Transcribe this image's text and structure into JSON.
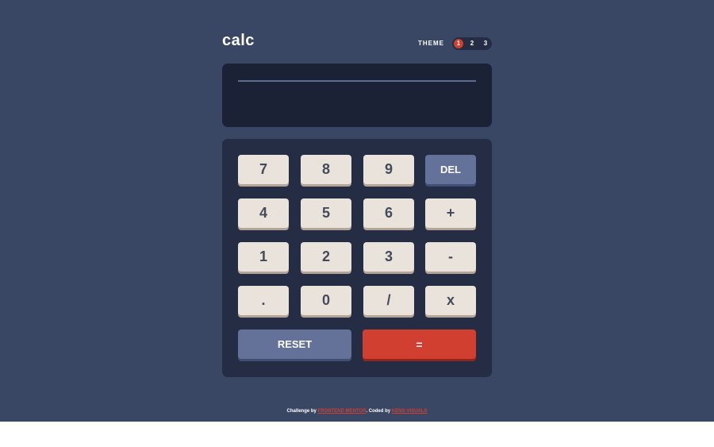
{
  "header": {
    "logo": "calc",
    "theme_label": "THEME",
    "theme_options": [
      "1",
      "2",
      "3"
    ],
    "theme_selected": "1"
  },
  "display": {
    "value": ""
  },
  "keys": {
    "seven": "7",
    "eight": "8",
    "nine": "9",
    "del": "DEL",
    "four": "4",
    "five": "5",
    "six": "6",
    "plus": "+",
    "one": "1",
    "two": "2",
    "three": "3",
    "minus": "-",
    "decimal": ".",
    "zero": "0",
    "divide": "/",
    "multiply": "x",
    "reset": "RESET",
    "equals": "="
  },
  "footer": {
    "prefix": "Challenge by",
    "challenge_link": "FRONTEND MENTOR",
    "middle": ". Coded by",
    "author_link": "KENS-VISUALS"
  },
  "colors": {
    "page_bg": "#3a4764",
    "screen_bg": "#1b2235",
    "keypad_bg": "#242d44",
    "key_bg": "#eae3dc",
    "key_blue": "#647198",
    "key_red": "#d03f2f"
  }
}
